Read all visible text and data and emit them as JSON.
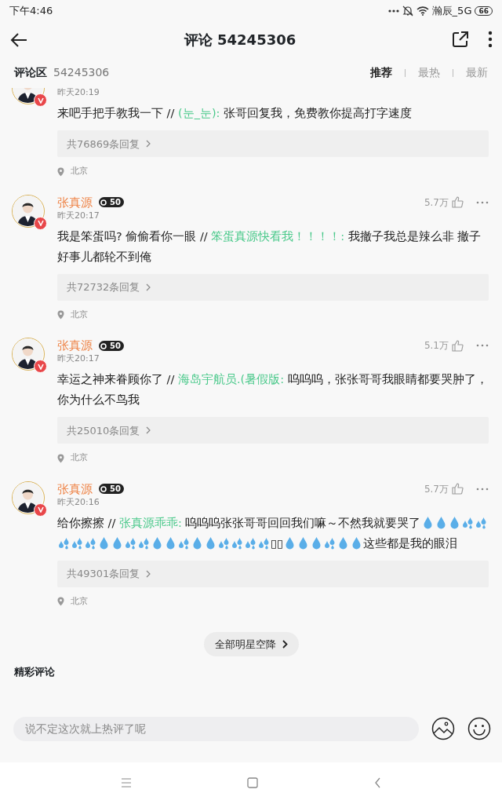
{
  "status_bar": {
    "time": "下午4:46",
    "network": "瀚辰_5G",
    "battery": "66"
  },
  "header": {
    "title": "评论 54245306"
  },
  "section": {
    "label": "评论区",
    "count": "54245306",
    "sorts": [
      {
        "label": "推荐",
        "selected": true
      },
      {
        "label": "最热",
        "selected": false
      },
      {
        "label": "最新",
        "selected": false
      }
    ]
  },
  "comments": [
    {
      "time": "昨天20:19",
      "message": [
        {
          "kind": "text",
          "text": "来吧手把手教我一下 // "
        },
        {
          "kind": "mention",
          "text": "(눈_눈):"
        },
        {
          "kind": "text",
          "text": " 张哥回复我，免费教你提高打字速度"
        }
      ],
      "replies": "共76869条回复",
      "location": "北京"
    },
    {
      "name": "张真源",
      "badge": "50",
      "likes": "5.7万",
      "time": "昨天20:17",
      "message": [
        {
          "kind": "text",
          "text": "我是笨蛋吗? 偷偷看你一眼 // "
        },
        {
          "kind": "mention",
          "text": "笨蛋真源快看我！！！！:"
        },
        {
          "kind": "text",
          "text": " 我撤子我总是辣么非 撤子好事儿都轮不到俺"
        }
      ],
      "replies": "共72732条回复",
      "location": "北京"
    },
    {
      "name": "张真源",
      "badge": "50",
      "likes": "5.1万",
      "time": "昨天20:17",
      "message": [
        {
          "kind": "text",
          "text": "幸运之神来眷顾你了 // "
        },
        {
          "kind": "mention",
          "text": "海岛宇航员.(暑假版:"
        },
        {
          "kind": "text",
          "text": " 呜呜呜，张张哥哥我眼睛都要哭肿了，你为什么不鸟我"
        }
      ],
      "replies": "共25010条回复",
      "location": "北京"
    },
    {
      "name": "张真源",
      "badge": "50",
      "likes": "5.7万",
      "time": "昨天20:16",
      "message": [
        {
          "kind": "text",
          "text": "给你擦擦 // "
        },
        {
          "kind": "mention",
          "text": "张真源乖乖:"
        },
        {
          "kind": "text",
          "text": " 呜呜呜张张哥哥回回我们嘛～不然我就要哭了"
        },
        {
          "kind": "drop"
        },
        {
          "kind": "drop"
        },
        {
          "kind": "drop"
        },
        {
          "kind": "splash"
        },
        {
          "kind": "splash"
        },
        {
          "kind": "splash"
        },
        {
          "kind": "splash"
        },
        {
          "kind": "splash"
        },
        {
          "kind": "drop"
        },
        {
          "kind": "drop"
        },
        {
          "kind": "splash"
        },
        {
          "kind": "splash"
        },
        {
          "kind": "drop"
        },
        {
          "kind": "drop"
        },
        {
          "kind": "splash"
        },
        {
          "kind": "drop"
        },
        {
          "kind": "drop"
        },
        {
          "kind": "splash"
        },
        {
          "kind": "splash"
        },
        {
          "kind": "splash"
        },
        {
          "kind": "splash"
        },
        {
          "kind": "text",
          "text": "▯▯"
        },
        {
          "kind": "drop"
        },
        {
          "kind": "drop"
        },
        {
          "kind": "drop"
        },
        {
          "kind": "splash"
        },
        {
          "kind": "drop"
        },
        {
          "kind": "drop"
        },
        {
          "kind": "text",
          "text": "这些都是我的眼泪"
        }
      ],
      "replies": "共49301条回复",
      "location": "北京"
    }
  ],
  "more_button": "全部明星空降",
  "featured_heading": "精彩评论",
  "composer": {
    "placeholder": "说不定这次就上热评了呢"
  }
}
